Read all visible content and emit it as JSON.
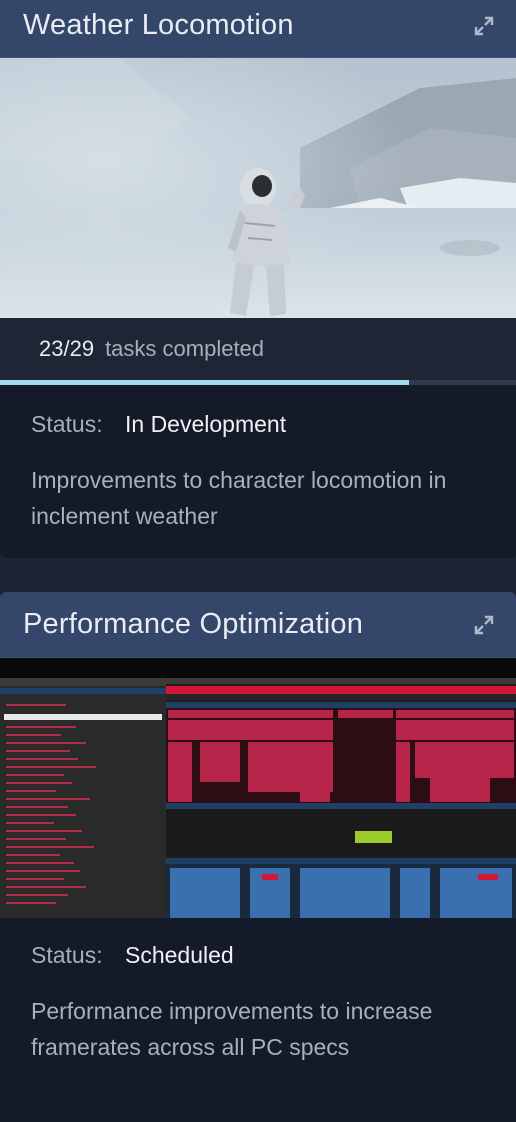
{
  "cards": [
    {
      "title": "Weather Locomotion",
      "image_alt": "Astronaut character in snowy fog",
      "tasks_done": "23/29",
      "tasks_label": "tasks completed",
      "progress": 0.7931,
      "status_label": "Status:",
      "status_value": "In Development",
      "description": "Improvements to character locomotion in inclement weather"
    },
    {
      "title": "Performance Optimization",
      "image_alt": "Profiler timeline screenshot",
      "status_label": "Status:",
      "status_value": "Scheduled",
      "description": "Performance improvements to increase framerates across all PC specs"
    }
  ],
  "colors": {
    "page_bg": "#1d2534",
    "card_bg": "#141a27",
    "header_bg": "#34476a",
    "progress_fill": "#a4d8ef"
  },
  "icons": {
    "expand": "expand-icon"
  }
}
